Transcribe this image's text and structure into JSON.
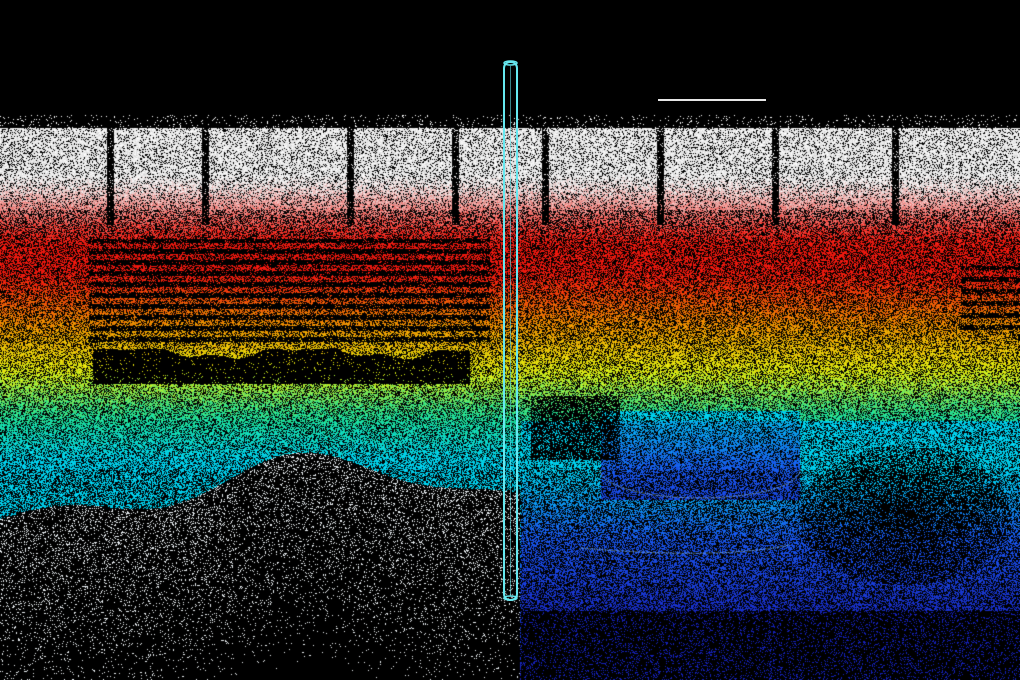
{
  "scene": {
    "kind": "lidar-point-cloud",
    "colormap": "jet-by-height",
    "colors": {
      "high": "#ffffff",
      "upper": "#ff1a10",
      "mid_upper": "#ffa000",
      "mid": "#f2ff10",
      "mid_lower": "#20f0a0",
      "low": "#00e0ff",
      "lower": "#1a5cff",
      "lowest": "#1a22c8",
      "background": "#000000",
      "marker": "#66e8f0"
    },
    "elements": {
      "vertical_marker": "cylinder-marker",
      "reference_line": "reference-line"
    }
  }
}
